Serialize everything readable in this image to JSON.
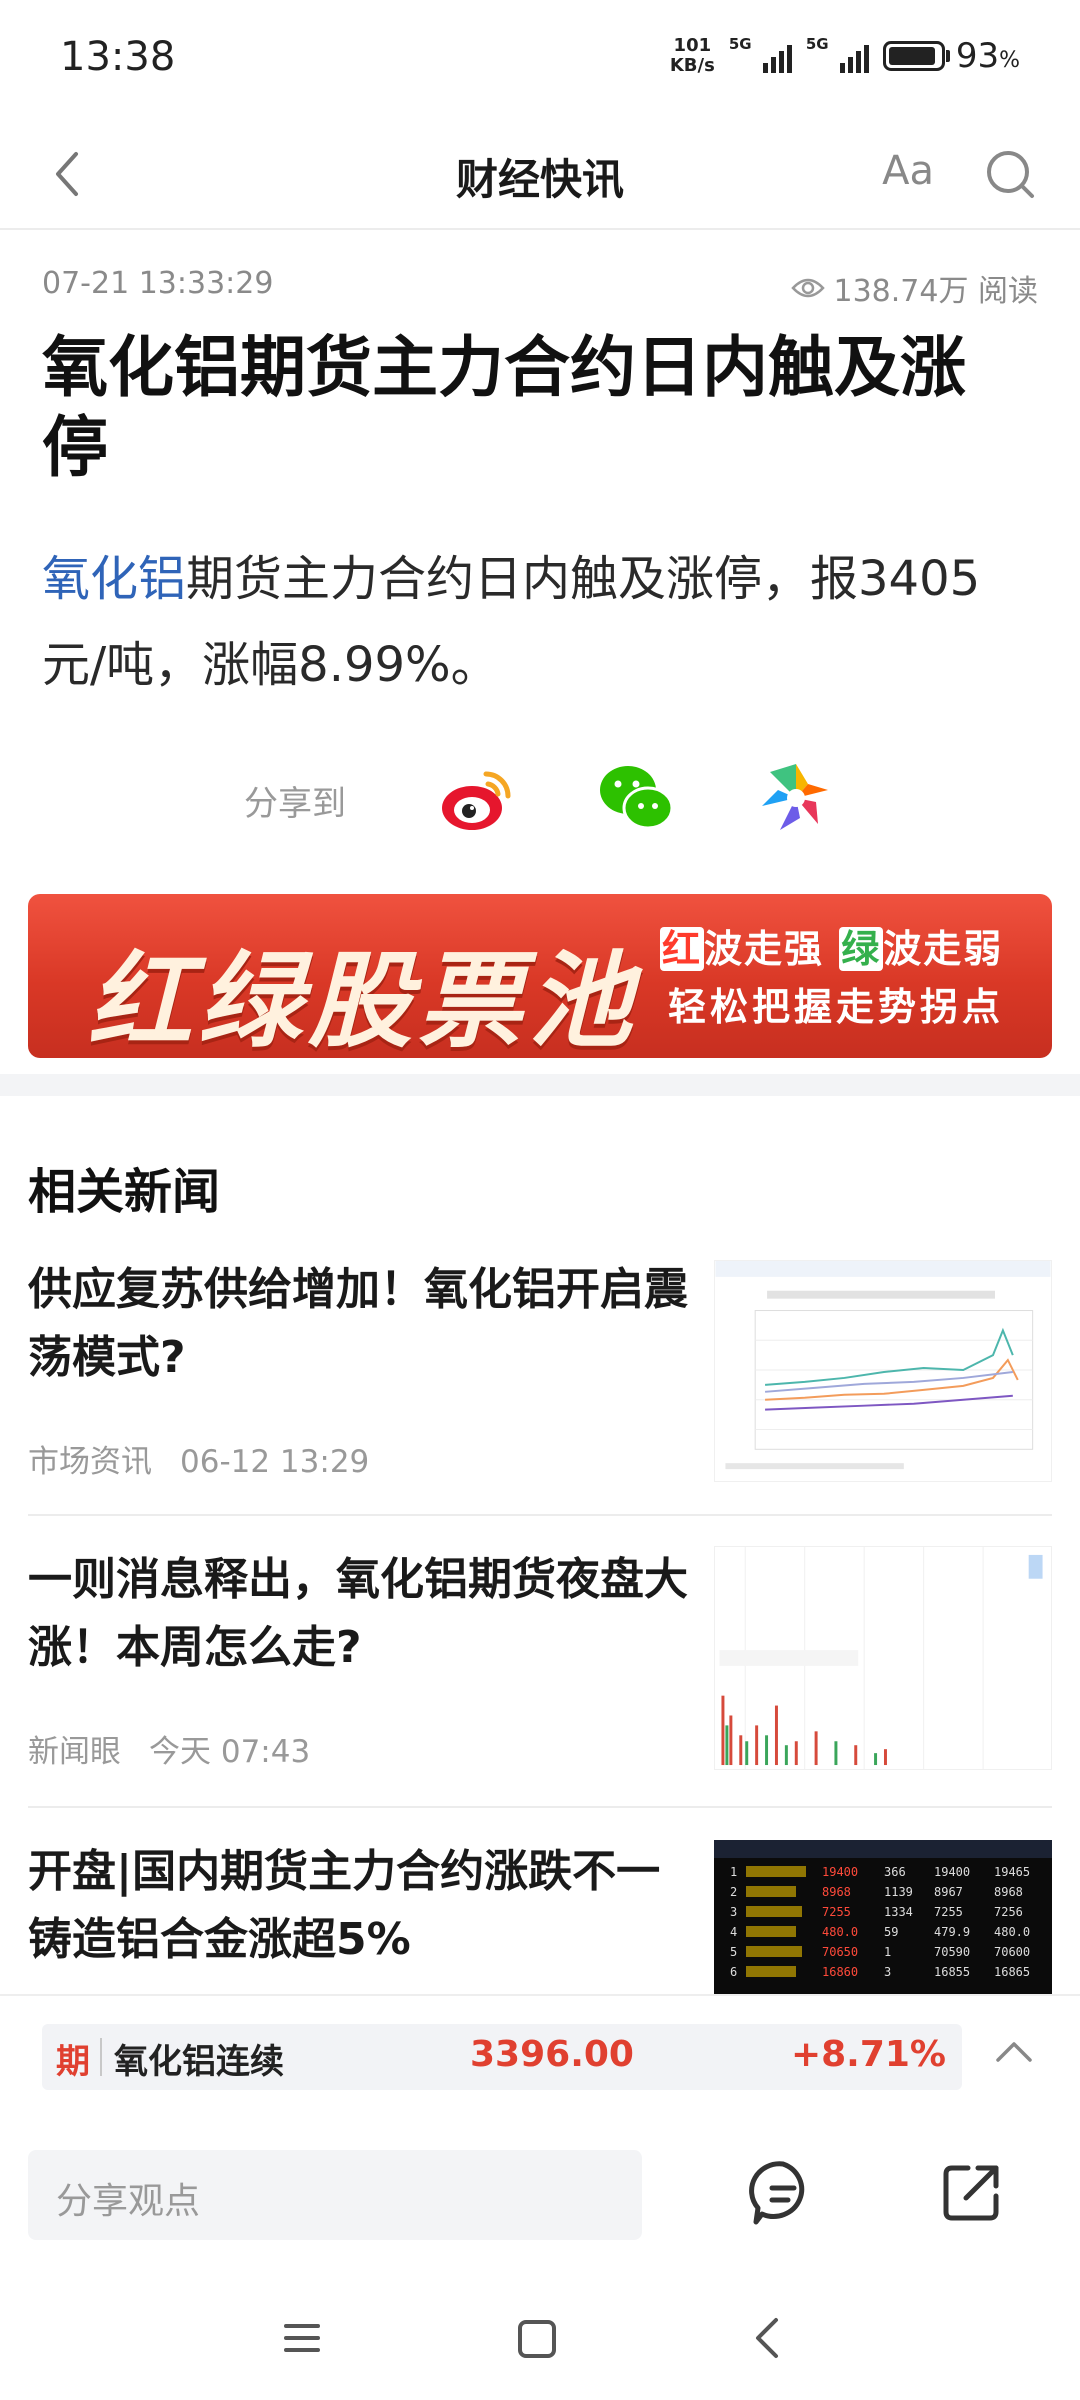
{
  "status_bar": {
    "time": "13:38",
    "net_speed_top": "101",
    "net_speed_bottom": "KB/s",
    "sim1": "5G",
    "sim2": "5G",
    "battery_pct": "93",
    "battery_unit": "%"
  },
  "nav": {
    "title": "财经快讯",
    "font_label": "Aa",
    "back_icon": "chevron-left-icon",
    "search_icon": "search-icon"
  },
  "article": {
    "datetime": "07-21 13:33:29",
    "read_count": "138.74万 阅读",
    "title": "氧化铝期货主力合约日内触及涨停",
    "body_keyword": "氧化铝",
    "body_rest": "期货主力合约日内触及涨停，报3405元/吨，涨幅8.99%。"
  },
  "share": {
    "label": "分享到",
    "targets": [
      "weibo-icon",
      "wechat-icon",
      "moments-icon"
    ]
  },
  "banner": {
    "main": "红绿股票池",
    "line1_red": "红",
    "line1_a": "波走强",
    "line1_green": "绿",
    "line1_b": "波走弱",
    "line2": "轻松把握走势拐点",
    "colors": {
      "red": "#d93826",
      "green": "#34b04c"
    }
  },
  "related": {
    "heading": "相关新闻",
    "items": [
      {
        "title": "供应复苏供给增加！氧化铝开启震荡模式?",
        "source": "市场资讯",
        "time": "06-12 13:29"
      },
      {
        "title": "一则消息释出，氧化铝期货夜盘大涨！本周怎么走?",
        "source": "新闻眼",
        "time": "今天 07:43"
      },
      {
        "title": "开盘|国内期货主力合约涨跌不一 铸造铝合金涨超5%",
        "source": "",
        "time": ""
      }
    ]
  },
  "quote_bar": {
    "tag": "期",
    "name": "氧化铝连续",
    "price": "3396.00",
    "change": "+8.71%",
    "up_color": "#e04030"
  },
  "comment_bar": {
    "placeholder": "分享观点",
    "comment_icon": "comment-icon",
    "share_icon": "share-out-icon"
  },
  "system_nav": [
    "menu-icon",
    "home-icon",
    "back-icon"
  ]
}
